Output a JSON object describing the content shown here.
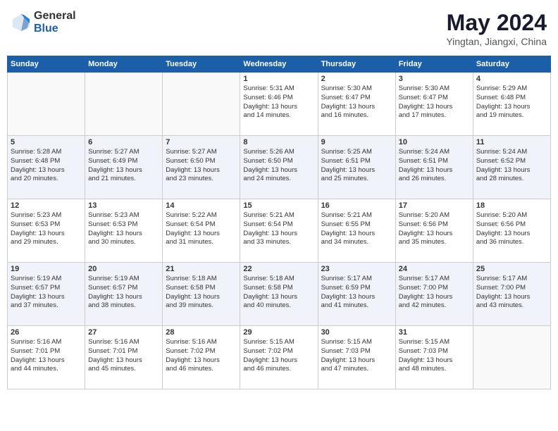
{
  "header": {
    "logo_general": "General",
    "logo_blue": "Blue",
    "title": "May 2024",
    "location": "Yingtan, Jiangxi, China"
  },
  "days_of_week": [
    "Sunday",
    "Monday",
    "Tuesday",
    "Wednesday",
    "Thursday",
    "Friday",
    "Saturday"
  ],
  "weeks": [
    [
      {
        "day": "",
        "info": ""
      },
      {
        "day": "",
        "info": ""
      },
      {
        "day": "",
        "info": ""
      },
      {
        "day": "1",
        "info": "Sunrise: 5:31 AM\nSunset: 6:46 PM\nDaylight: 13 hours\nand 14 minutes."
      },
      {
        "day": "2",
        "info": "Sunrise: 5:30 AM\nSunset: 6:47 PM\nDaylight: 13 hours\nand 16 minutes."
      },
      {
        "day": "3",
        "info": "Sunrise: 5:30 AM\nSunset: 6:47 PM\nDaylight: 13 hours\nand 17 minutes."
      },
      {
        "day": "4",
        "info": "Sunrise: 5:29 AM\nSunset: 6:48 PM\nDaylight: 13 hours\nand 19 minutes."
      }
    ],
    [
      {
        "day": "5",
        "info": "Sunrise: 5:28 AM\nSunset: 6:48 PM\nDaylight: 13 hours\nand 20 minutes."
      },
      {
        "day": "6",
        "info": "Sunrise: 5:27 AM\nSunset: 6:49 PM\nDaylight: 13 hours\nand 21 minutes."
      },
      {
        "day": "7",
        "info": "Sunrise: 5:27 AM\nSunset: 6:50 PM\nDaylight: 13 hours\nand 23 minutes."
      },
      {
        "day": "8",
        "info": "Sunrise: 5:26 AM\nSunset: 6:50 PM\nDaylight: 13 hours\nand 24 minutes."
      },
      {
        "day": "9",
        "info": "Sunrise: 5:25 AM\nSunset: 6:51 PM\nDaylight: 13 hours\nand 25 minutes."
      },
      {
        "day": "10",
        "info": "Sunrise: 5:24 AM\nSunset: 6:51 PM\nDaylight: 13 hours\nand 26 minutes."
      },
      {
        "day": "11",
        "info": "Sunrise: 5:24 AM\nSunset: 6:52 PM\nDaylight: 13 hours\nand 28 minutes."
      }
    ],
    [
      {
        "day": "12",
        "info": "Sunrise: 5:23 AM\nSunset: 6:53 PM\nDaylight: 13 hours\nand 29 minutes."
      },
      {
        "day": "13",
        "info": "Sunrise: 5:23 AM\nSunset: 6:53 PM\nDaylight: 13 hours\nand 30 minutes."
      },
      {
        "day": "14",
        "info": "Sunrise: 5:22 AM\nSunset: 6:54 PM\nDaylight: 13 hours\nand 31 minutes."
      },
      {
        "day": "15",
        "info": "Sunrise: 5:21 AM\nSunset: 6:54 PM\nDaylight: 13 hours\nand 33 minutes."
      },
      {
        "day": "16",
        "info": "Sunrise: 5:21 AM\nSunset: 6:55 PM\nDaylight: 13 hours\nand 34 minutes."
      },
      {
        "day": "17",
        "info": "Sunrise: 5:20 AM\nSunset: 6:56 PM\nDaylight: 13 hours\nand 35 minutes."
      },
      {
        "day": "18",
        "info": "Sunrise: 5:20 AM\nSunset: 6:56 PM\nDaylight: 13 hours\nand 36 minutes."
      }
    ],
    [
      {
        "day": "19",
        "info": "Sunrise: 5:19 AM\nSunset: 6:57 PM\nDaylight: 13 hours\nand 37 minutes."
      },
      {
        "day": "20",
        "info": "Sunrise: 5:19 AM\nSunset: 6:57 PM\nDaylight: 13 hours\nand 38 minutes."
      },
      {
        "day": "21",
        "info": "Sunrise: 5:18 AM\nSunset: 6:58 PM\nDaylight: 13 hours\nand 39 minutes."
      },
      {
        "day": "22",
        "info": "Sunrise: 5:18 AM\nSunset: 6:58 PM\nDaylight: 13 hours\nand 40 minutes."
      },
      {
        "day": "23",
        "info": "Sunrise: 5:17 AM\nSunset: 6:59 PM\nDaylight: 13 hours\nand 41 minutes."
      },
      {
        "day": "24",
        "info": "Sunrise: 5:17 AM\nSunset: 7:00 PM\nDaylight: 13 hours\nand 42 minutes."
      },
      {
        "day": "25",
        "info": "Sunrise: 5:17 AM\nSunset: 7:00 PM\nDaylight: 13 hours\nand 43 minutes."
      }
    ],
    [
      {
        "day": "26",
        "info": "Sunrise: 5:16 AM\nSunset: 7:01 PM\nDaylight: 13 hours\nand 44 minutes."
      },
      {
        "day": "27",
        "info": "Sunrise: 5:16 AM\nSunset: 7:01 PM\nDaylight: 13 hours\nand 45 minutes."
      },
      {
        "day": "28",
        "info": "Sunrise: 5:16 AM\nSunset: 7:02 PM\nDaylight: 13 hours\nand 46 minutes."
      },
      {
        "day": "29",
        "info": "Sunrise: 5:15 AM\nSunset: 7:02 PM\nDaylight: 13 hours\nand 46 minutes."
      },
      {
        "day": "30",
        "info": "Sunrise: 5:15 AM\nSunset: 7:03 PM\nDaylight: 13 hours\nand 47 minutes."
      },
      {
        "day": "31",
        "info": "Sunrise: 5:15 AM\nSunset: 7:03 PM\nDaylight: 13 hours\nand 48 minutes."
      },
      {
        "day": "",
        "info": ""
      }
    ]
  ]
}
